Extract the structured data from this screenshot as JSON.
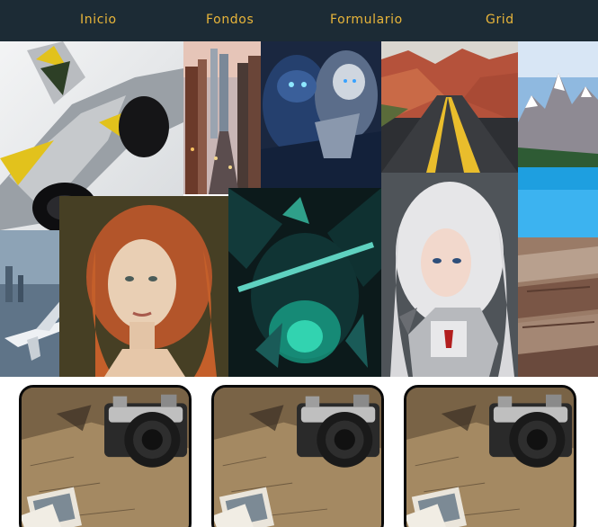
{
  "nav": {
    "items": [
      {
        "label": "Inicio"
      },
      {
        "label": "Fondos"
      },
      {
        "label": "Formulario"
      },
      {
        "label": "Grid"
      }
    ]
  },
  "gallery": {
    "images": [
      {
        "name": "fighter-jet"
      },
      {
        "name": "city-street"
      },
      {
        "name": "blue-warrior"
      },
      {
        "name": "canyon-road"
      },
      {
        "name": "mountain-lake"
      },
      {
        "name": "airplane-city"
      },
      {
        "name": "red-hair-woman"
      },
      {
        "name": "green-demon"
      },
      {
        "name": "white-hair-warrior"
      },
      {
        "name": "wood-rock"
      }
    ]
  },
  "cards": [
    {
      "image": "vintage-camera-map"
    },
    {
      "image": "vintage-camera-map"
    },
    {
      "image": "vintage-camera-map"
    }
  ],
  "colors": {
    "nav_bg": "#1c2b35",
    "nav_text": "#e8b53a",
    "card_border": "#0a0a0a"
  }
}
